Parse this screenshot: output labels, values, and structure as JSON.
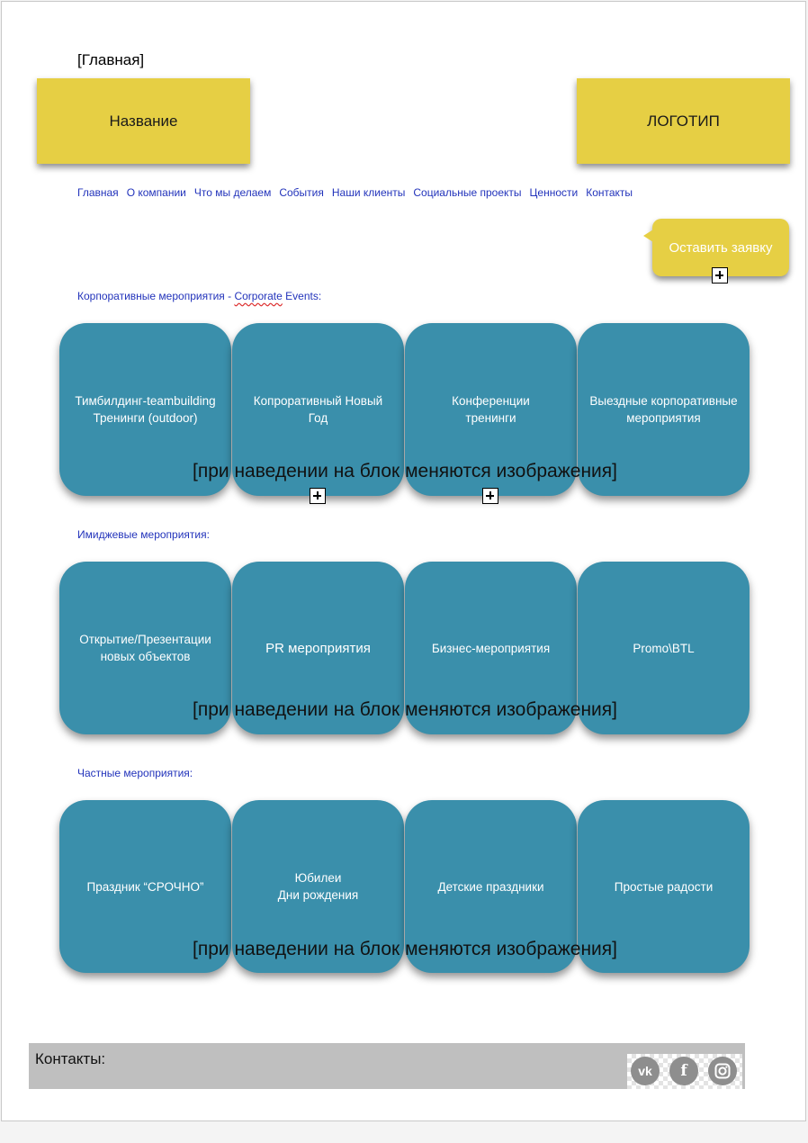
{
  "breadcrumb": "[Главная]",
  "header": {
    "name_label": "Название",
    "logo_label": "ЛОГОТИП"
  },
  "nav": [
    "Главная",
    "О компании",
    "Что мы делаем",
    "События",
    "Наши клиенты",
    "Социальные проекты",
    "Ценности",
    "Контакты"
  ],
  "cta": {
    "label": "Оставить заявку"
  },
  "sections": [
    {
      "title_prefix": "Корпоративные мероприятия - ",
      "title_underlined": "Corporate",
      "title_suffix": " Events:",
      "tiles": [
        "Тимбилдинг-teambuilding\nТренинги (outdoor)",
        "Копроративный Новый\nГод",
        "Конференции\nтренинги",
        "Выездные корпоративные\nмероприятия"
      ],
      "hover_note": "[при наведении на блок меняются изображения]"
    },
    {
      "title": "Имиджевые мероприятия:",
      "tiles": [
        "Открытие/Презентации\nновых объектов",
        "PR мероприятия",
        "Бизнес-мероприятия",
        "Promo\\BTL"
      ],
      "hover_note": "[при наведении на блок меняются изображения]"
    },
    {
      "title": "Частные мероприятия:",
      "tiles": [
        "Праздник “СРОЧНО”",
        "Юбилеи\nДни рождения",
        "Детские праздники",
        "Простые радости"
      ],
      "hover_note": "[при наведении на блок меняются изображения]"
    }
  ],
  "footer": {
    "label": "Контакты:"
  },
  "social": {
    "vk": "vk",
    "fb": "f"
  },
  "colors": {
    "sticky": "#e6cf44",
    "tile": "#3a8fab",
    "link": "#2233bb",
    "footer": "#bfbfbf"
  }
}
